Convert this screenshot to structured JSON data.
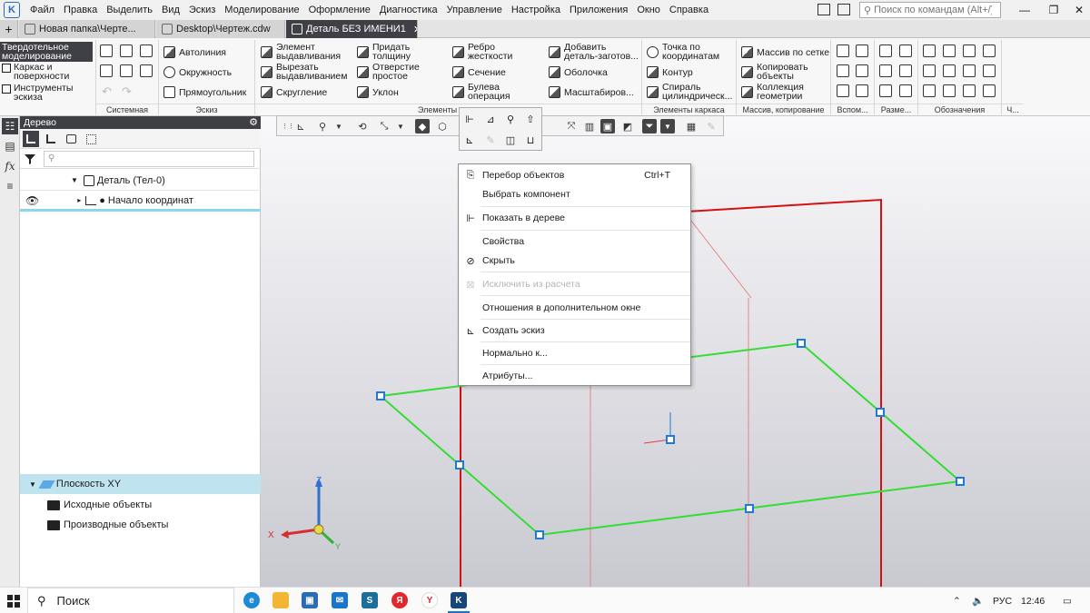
{
  "menubar": {
    "items": [
      "Файл",
      "Правка",
      "Выделить",
      "Вид",
      "Эскиз",
      "Моделирование",
      "Оформление",
      "Диагностика",
      "Управление",
      "Настройка",
      "Приложения",
      "Окно",
      "Справка"
    ],
    "search_placeholder": "Поиск по командам (Alt+/)"
  },
  "tabs": [
    {
      "label": "Новая папка\\Черте...",
      "active": false
    },
    {
      "label": "Desktop\\Чертеж.cdw",
      "active": false
    },
    {
      "label": "Деталь БЕЗ ИМЕНИ1",
      "active": true
    }
  ],
  "ribbon": {
    "modes": [
      "Твердотельное моделирование",
      "Каркас и поверхности",
      "Инструменты эскиза"
    ],
    "sketch": [
      "Автолиния",
      "Окружность",
      "Прямоугольник"
    ],
    "elements": [
      "Элемент выдавливания",
      "Вырезать выдавливанием",
      "Скругление",
      "Придать толщину",
      "Отверстие простое",
      "Уклон",
      "Ребро жесткости",
      "Сечение",
      "Булева операция",
      "Добавить деталь-заготов...",
      "Оболочка",
      "Масштабиров..."
    ],
    "frame": [
      "Точка по координатам",
      "Контур",
      "Спираль цилиндрическ..."
    ],
    "copy": [
      "Массив по сетке",
      "Копировать объекты",
      "Коллекция геометрии"
    ],
    "group_labels": [
      "Системная",
      "Эскиз",
      "Элементы тел...",
      "Элементы каркаса",
      "Массив, копирование",
      "Вспом...",
      "Разме...",
      "Обозначения",
      "Ч..."
    ]
  },
  "tree": {
    "title": "Дерево",
    "root": "Деталь (Тел-0)",
    "origin": "Начало координат",
    "plane": "Плоскость XY",
    "folders": [
      "Исходные объекты",
      "Производные объекты"
    ]
  },
  "context_menu": {
    "items": [
      {
        "label": "Перебор объектов",
        "shortcut": "Ctrl+T",
        "disabled": false
      },
      {
        "label": "Выбрать компонент",
        "disabled": false
      },
      {
        "label": "Показать в дереве",
        "disabled": false
      },
      {
        "label": "Свойства",
        "disabled": false
      },
      {
        "label": "Скрыть",
        "disabled": false
      },
      {
        "label": "Исключить из расчета",
        "disabled": true
      },
      {
        "label": "Отношения в дополнительном окне",
        "disabled": false
      },
      {
        "label": "Создать эскиз",
        "disabled": false
      },
      {
        "label": "Нормально к...",
        "disabled": false
      },
      {
        "label": "Атрибуты...",
        "disabled": false
      }
    ]
  },
  "axes": {
    "x": "X",
    "z": "Z",
    "y": "Y"
  },
  "taskbar": {
    "search": "Поиск",
    "lang": "РУС",
    "time": "12:46"
  },
  "colors": {
    "accent": "#3f3f46",
    "plane": "#33dd33",
    "red": "#d41111",
    "handle": "#1d7ad8"
  }
}
